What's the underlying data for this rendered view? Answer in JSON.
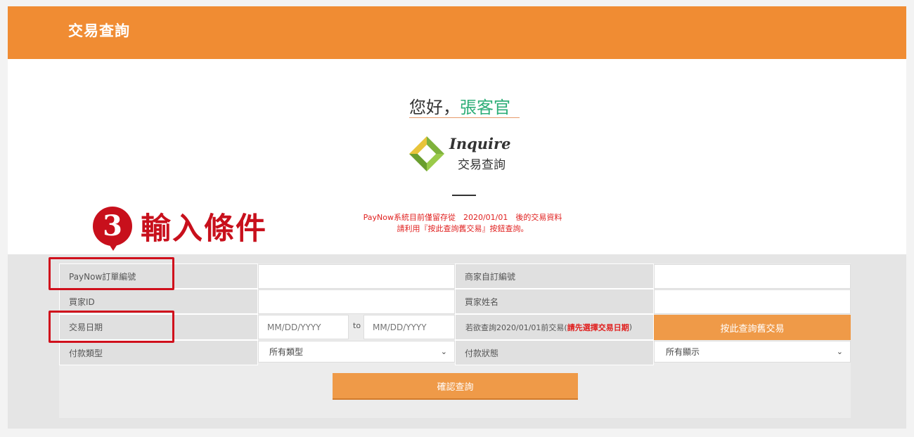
{
  "header": {
    "title": "交易查詢"
  },
  "greeting": {
    "prefix": "您好，",
    "name": "張客官"
  },
  "logo": {
    "english": "Inquire",
    "chinese": "交易查詢"
  },
  "notice": {
    "line1": "PayNow系統目前僅留存從　2020/01/01　後的交易資料",
    "line2": "請利用『按此查詢舊交易』按鈕查詢。"
  },
  "annotation": {
    "number": "3",
    "text": "輸入條件"
  },
  "form": {
    "paynow_order_label": "PayNow訂單編號",
    "paynow_order_value": "",
    "merchant_no_label": "商家自訂編號",
    "merchant_no_value": "",
    "buyer_id_label": "買家ID",
    "buyer_id_value": "",
    "buyer_name_label": "買家姓名",
    "buyer_name_value": "",
    "date_label": "交易日期",
    "date_from_placeholder": "MM/DD/YYYY",
    "date_to_placeholder": "MM/DD/YYYY",
    "date_sep": "to",
    "old_query_hint_prefix": "若欲查詢2020/01/01前交易(",
    "old_query_hint_red": "請先選擇交易日期",
    "old_query_hint_suffix": ")",
    "old_query_button": "按此查詢舊交易",
    "pay_type_label": "付款類型",
    "pay_type_selected": "所有類型",
    "pay_status_label": "付款狀態",
    "pay_status_selected": "所有顯示",
    "submit": "確認查詢"
  },
  "colors": {
    "header_bg": "#f08c33",
    "accent_green": "#2eae78",
    "button_orange": "#ef9a48",
    "annotation_red": "#c8101c"
  },
  "icons": [
    "inquire-logo-icon",
    "chevron-down-icon"
  ]
}
